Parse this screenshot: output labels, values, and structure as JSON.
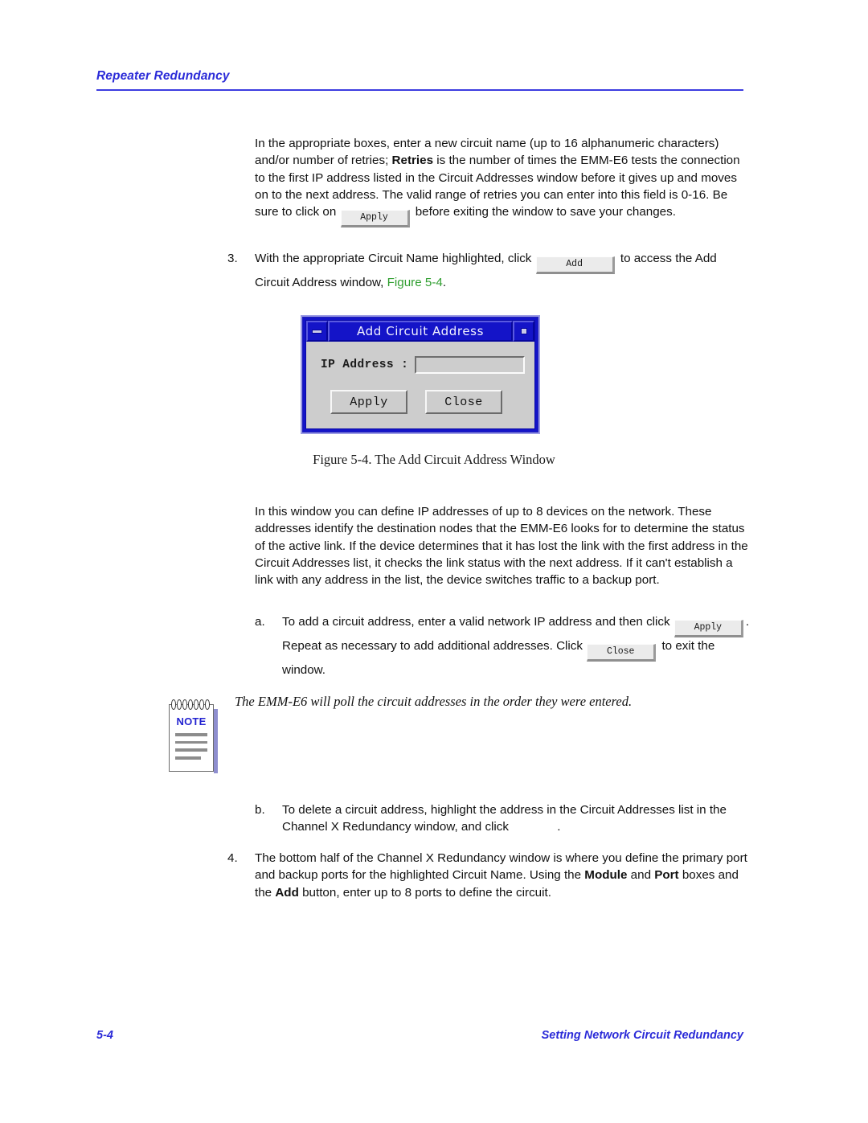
{
  "header": {
    "title": "Repeater Redundancy"
  },
  "intro_paragraph": {
    "part1": "In the appropriate boxes, enter a new circuit name (up to 16 alphanumeric characters) and/or number of retries; ",
    "bold1": "Retries",
    "part2": " is the number of times the EMM-E6 tests the connection to the first IP address listed in the Circuit Addresses window before it gives up and moves on to the next address. The valid range of retries you can enter into this field is 0-16. Be sure to click on ",
    "inline_button": "Apply",
    "part3": " before exiting the window to save your changes."
  },
  "step3": {
    "marker": "3.",
    "part1": "With the appropriate Circuit Name highlighted, click ",
    "inline_button": "Add",
    "part2": " to access the Add Circuit Address window, ",
    "xref": "Figure 5-4",
    "part3": "."
  },
  "dialog": {
    "title": "Add Circuit Address",
    "minimize_icon": "minimize-icon",
    "maximize_icon": "maximize-icon",
    "field_label": "IP Address :",
    "field_value": "",
    "field_placeholder": "",
    "apply_label": "Apply",
    "close_label": "Close",
    "titlebar_color": "#1414C8",
    "face_color": "#cdcdcd"
  },
  "figure_caption": "Figure 5-4.  The Add Circuit Address Window",
  "body_paragraph": "In this window you can define IP addresses of up to 8 devices on the network. These addresses identify the destination nodes that the EMM-E6 looks for to determine the status of the active link. If the device determines that it has lost the link with the first address in the Circuit Addresses list, it checks the link status with the next address. If it can't establish a link with any address in the list, the device switches traffic to a backup port.",
  "step_a": {
    "marker": "a.",
    "part1": "To add a circuit address, enter a valid network IP address and then click ",
    "inline_button_1": "Apply",
    "part2": ". Repeat as necessary to add additional addresses. Click ",
    "inline_button_2": "Close",
    "part3": " to exit the window."
  },
  "note": {
    "label": "NOTE",
    "text": "The EMM-E6 will poll the circuit addresses in the order they were entered.",
    "label_color": "#2323D0"
  },
  "step_b": {
    "marker": "b.",
    "part1": "To delete a circuit address, highlight the address in the Circuit Addresses list in the Channel X Redundancy window, and click ",
    "part2": "."
  },
  "step4": {
    "marker": "4.",
    "part1": "The bottom half of the Channel X Redundancy window is where you define the primary port and backup ports for the highlighted Circuit Name. Using the ",
    "bold1": "Module",
    "part2": " and ",
    "bold2": "Port",
    "part3": " boxes and the ",
    "bold3": "Add",
    "part4": " button, enter up to 8 ports to define the circuit."
  },
  "footer": {
    "page_number": "5-4",
    "section": "Setting Network Circuit Redundancy"
  }
}
